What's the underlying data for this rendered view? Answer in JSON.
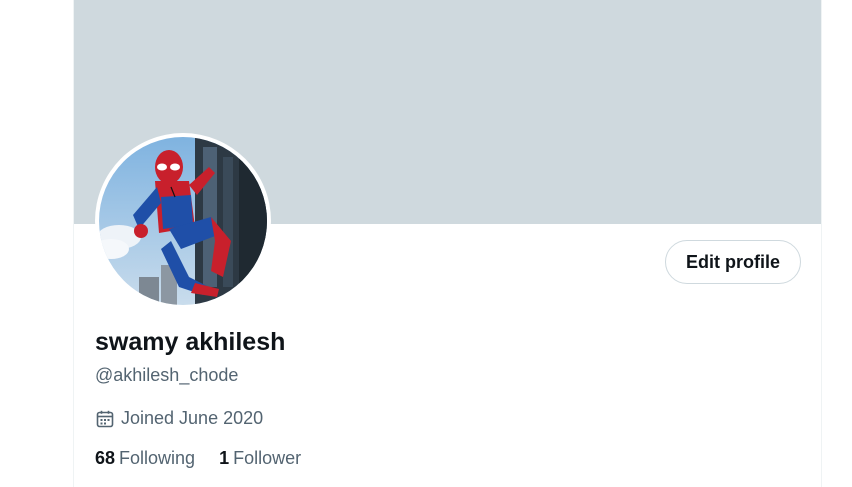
{
  "profile": {
    "display_name": "swamy akhilesh",
    "handle": "@akhilesh_chode",
    "joined": "Joined June 2020",
    "edit_button_label": "Edit profile",
    "avatar_description": "spider-man-avatar"
  },
  "stats": {
    "following_count": "68",
    "following_label": "Following",
    "followers_count": "1",
    "followers_label": "Follower"
  },
  "icons": {
    "joined": "calendar-icon"
  },
  "colors": {
    "banner": "#cfd9de",
    "primary_text": "#0f1419",
    "secondary_text": "#536471",
    "border": "#cfd9de"
  }
}
